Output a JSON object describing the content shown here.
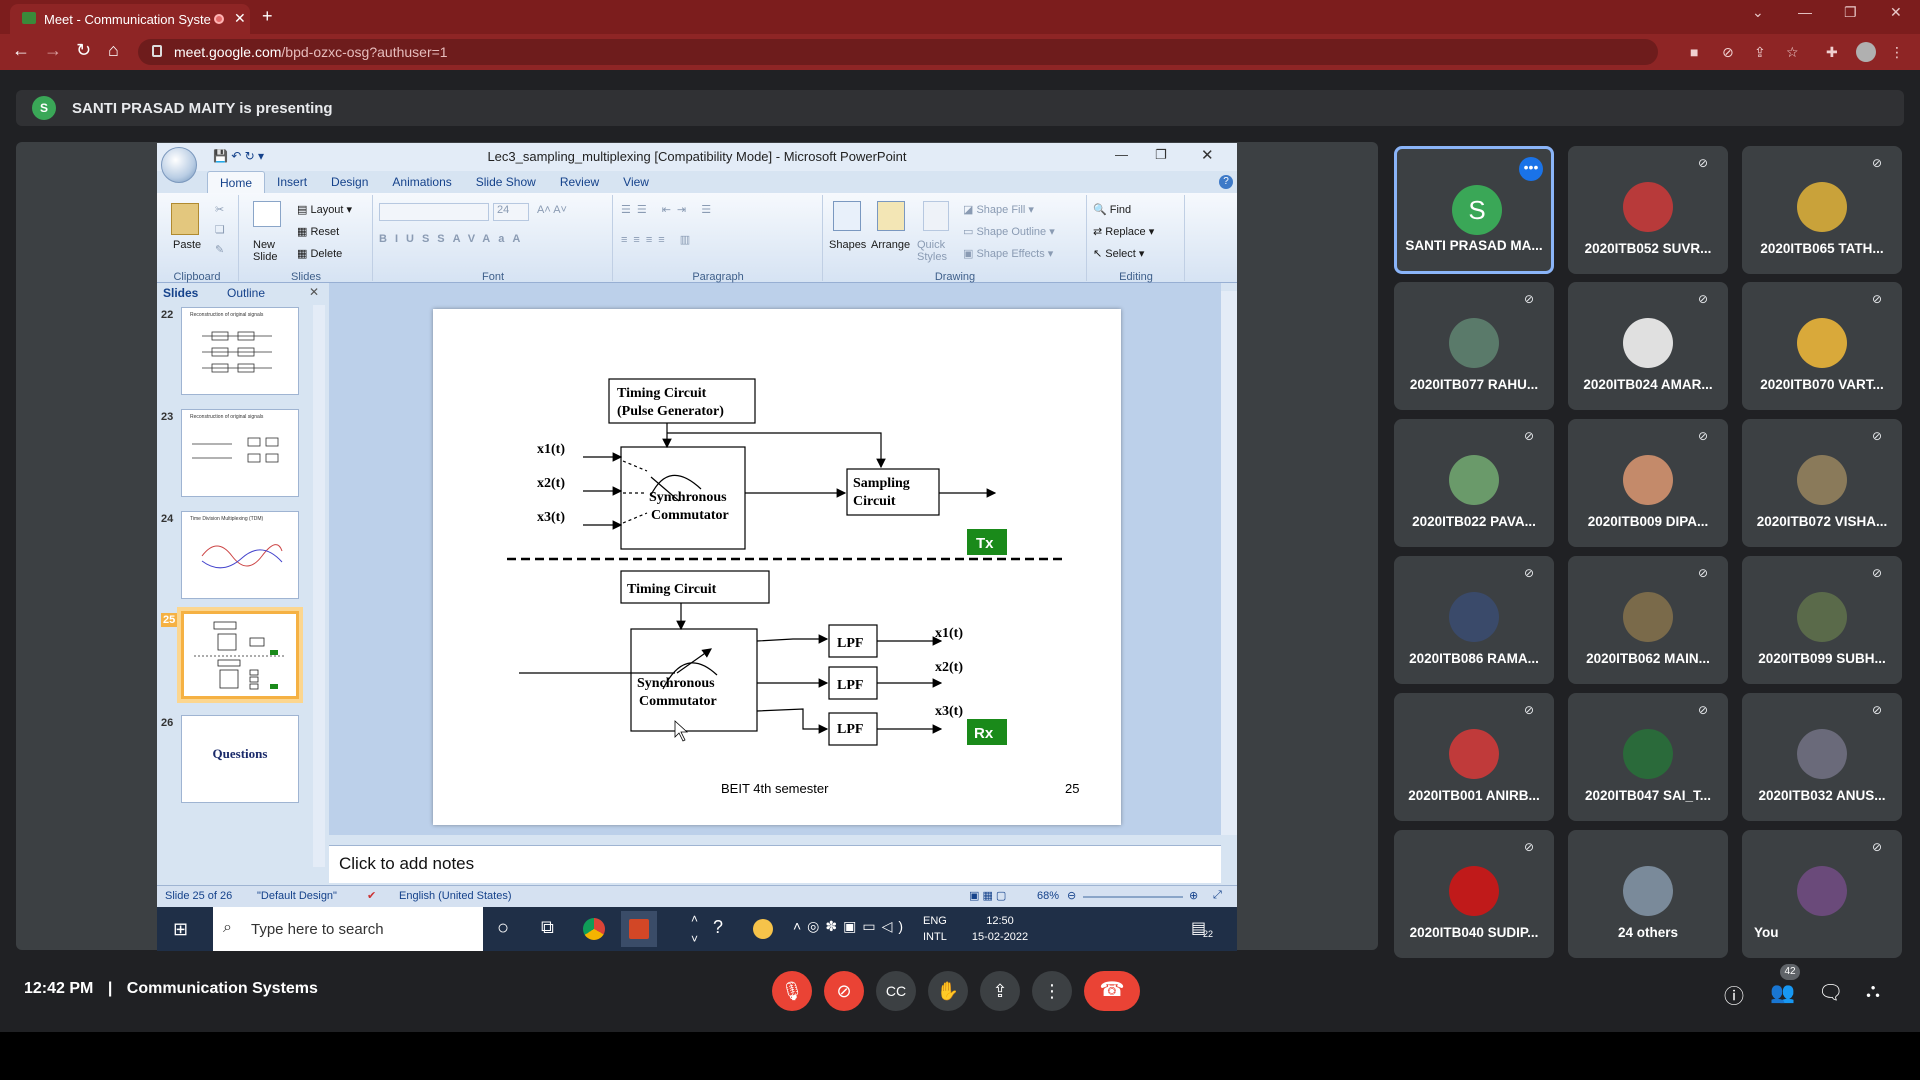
{
  "browser": {
    "tab_title": "Meet - Communication Syste",
    "url_host": "meet.google.com",
    "url_path": "/bpd-ozxc-osg?authuser=1"
  },
  "banner": {
    "avatar_letter": "S",
    "text": "SANTI PRASAD MAITY is presenting"
  },
  "ppt": {
    "window_title": "Lec3_sampling_multiplexing [Compatibility Mode] - Microsoft PowerPoint",
    "tabs": [
      "Home",
      "Insert",
      "Design",
      "Animations",
      "Slide Show",
      "Review",
      "View"
    ],
    "groups": {
      "clipboard": "Clipboard",
      "slides": "Slides",
      "font": "Font",
      "paragraph": "Paragraph",
      "drawing": "Drawing",
      "editing": "Editing"
    },
    "buttons": {
      "paste": "Paste",
      "new_slide": "New Slide",
      "layout": "Layout",
      "reset": "Reset",
      "delete": "Delete",
      "font_size": "24",
      "shapes": "Shapes",
      "arrange": "Arrange",
      "quick_styles": "Quick Styles",
      "shape_fill": "Shape Fill",
      "shape_outline": "Shape Outline",
      "shape_effects": "Shape Effects",
      "find": "Find",
      "replace": "Replace",
      "select": "Select"
    },
    "panel_tabs": [
      "Slides",
      "Outline"
    ],
    "thumbs": [
      {
        "num": "22",
        "title": "Reconstruction of original signals"
      },
      {
        "num": "23",
        "title": "Reconstruction of original signals"
      },
      {
        "num": "24",
        "title": "Time Division Multiplexing (TDM)"
      },
      {
        "num": "25",
        "title": ""
      },
      {
        "num": "26",
        "title": "Questions"
      }
    ],
    "slide": {
      "tx_timing": "Timing Circuit",
      "tx_timing2": "(Pulse Generator)",
      "inputs": [
        "x1(t)",
        "x2(t)",
        "x3(t)"
      ],
      "commutator": "Synchronous",
      "commutator2": "Commutator",
      "sampling": "Sampling",
      "sampling2": "Circuit",
      "tx_tag": "Tx",
      "rx_timing": "Timing Circuit",
      "lpf": [
        "LPF",
        "LPF",
        "LPF"
      ],
      "outputs": [
        "x1(t)",
        "x2(t)",
        "x3(t)"
      ],
      "rx_tag": "Rx",
      "footer": "BEIT 4th semester",
      "page_num": "25"
    },
    "notes": "Click to add notes",
    "status": {
      "slide_of": "Slide 25 of 26",
      "design": "\"Default Design\"",
      "language": "English (United States)",
      "zoom": "68%"
    }
  },
  "taskbar": {
    "search": "Type here to search",
    "lang1": "ENG",
    "lang2": "INTL",
    "time": "12:50",
    "date": "15-02-2022",
    "notif": "22"
  },
  "participants": [
    {
      "name": "SANTI PRASAD MA...",
      "color": "#3aa757",
      "letter": "S",
      "active": true
    },
    {
      "name": "2020ITB052 SUVR...",
      "color": "#b83a3a"
    },
    {
      "name": "2020ITB065 TATH...",
      "color": "#c9a23a"
    },
    {
      "name": "2020ITB077 RAHU...",
      "color": "#5a7a6a"
    },
    {
      "name": "2020ITB024 AMAR...",
      "color": "#e0e0e0"
    },
    {
      "name": "2020ITB070 VART...",
      "color": "#d9a93a"
    },
    {
      "name": "2020ITB022 PAVA...",
      "color": "#6a9a6a"
    },
    {
      "name": "2020ITB009 DIPA...",
      "color": "#c48a6a"
    },
    {
      "name": "2020ITB072 VISHA...",
      "color": "#8a7a5a"
    },
    {
      "name": "2020ITB086 RAMA...",
      "color": "#3a4a6a"
    },
    {
      "name": "2020ITB062 MAIN...",
      "color": "#7a6a4a"
    },
    {
      "name": "2020ITB099 SUBH...",
      "color": "#5a6a4a"
    },
    {
      "name": "2020ITB001 ANIRB...",
      "color": "#c03a3a"
    },
    {
      "name": "2020ITB047 SAI_T...",
      "color": "#2a6a3a"
    },
    {
      "name": "2020ITB032 ANUS...",
      "color": "#6a6a7a"
    },
    {
      "name": "2020ITB040 SUDIP...",
      "color": "#c01a1a"
    },
    {
      "name": "24 others",
      "color": "#7a8a9a"
    },
    {
      "name": "You",
      "color": "#6a4a7a"
    }
  ],
  "bottom": {
    "time": "12:42 PM",
    "separator": "|",
    "meeting": "Communication Systems",
    "people_count": "42"
  }
}
